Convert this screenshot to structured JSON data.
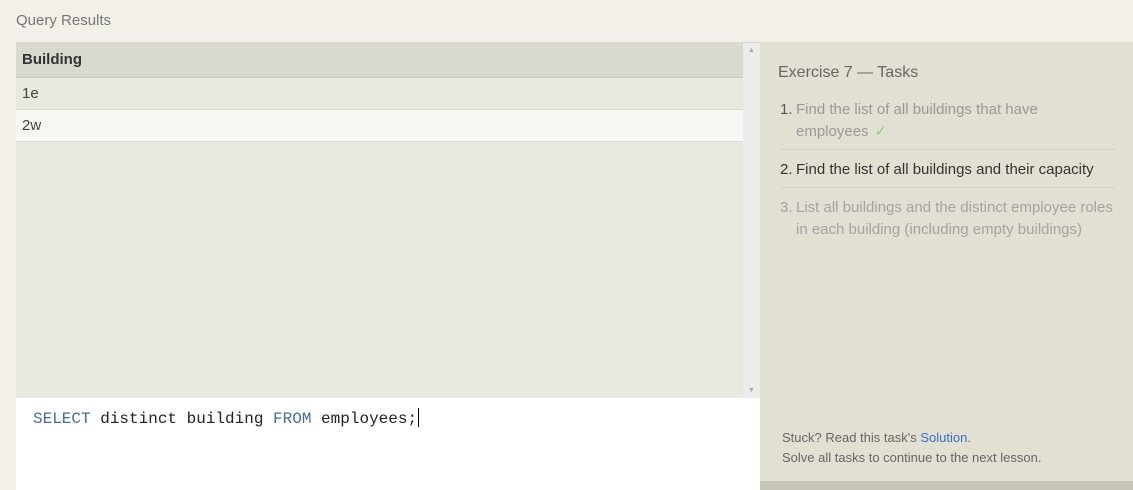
{
  "results": {
    "header": "Query Results",
    "columns": [
      "Building"
    ],
    "rows": [
      [
        "1e"
      ],
      [
        "2w"
      ]
    ]
  },
  "scrollbar": {
    "up_arrow": "▲",
    "down_arrow": "▼"
  },
  "editor": {
    "tokens": [
      {
        "text": "SELECT",
        "kind": "keyword"
      },
      {
        "text": " distinct building ",
        "kind": "plain"
      },
      {
        "text": "FROM",
        "kind": "keyword"
      },
      {
        "text": " employees;",
        "kind": "plain"
      }
    ]
  },
  "tasks": {
    "title": "Exercise 7 — Tasks",
    "items": [
      {
        "num": "1.",
        "text": "Find the list of all buildings that have employees",
        "check": "✓",
        "status": "done"
      },
      {
        "num": "2.",
        "text": "Find the list of all buildings and their capacity",
        "status": "current"
      },
      {
        "num": "3.",
        "text": "List all buildings and the distinct employee roles in each building (including empty buildings)",
        "status": "pending"
      }
    ]
  },
  "footer": {
    "stuck_prefix": "Stuck? Read this task's ",
    "solution_link": "Solution",
    "stuck_suffix": ".",
    "continue_text": "Solve all tasks to continue to the next lesson."
  },
  "colors": {
    "keyword": "#4a6a9a",
    "link": "#3a6fcf",
    "check": "#8fcc8f",
    "tasks_bg": "#e2e0d2"
  }
}
